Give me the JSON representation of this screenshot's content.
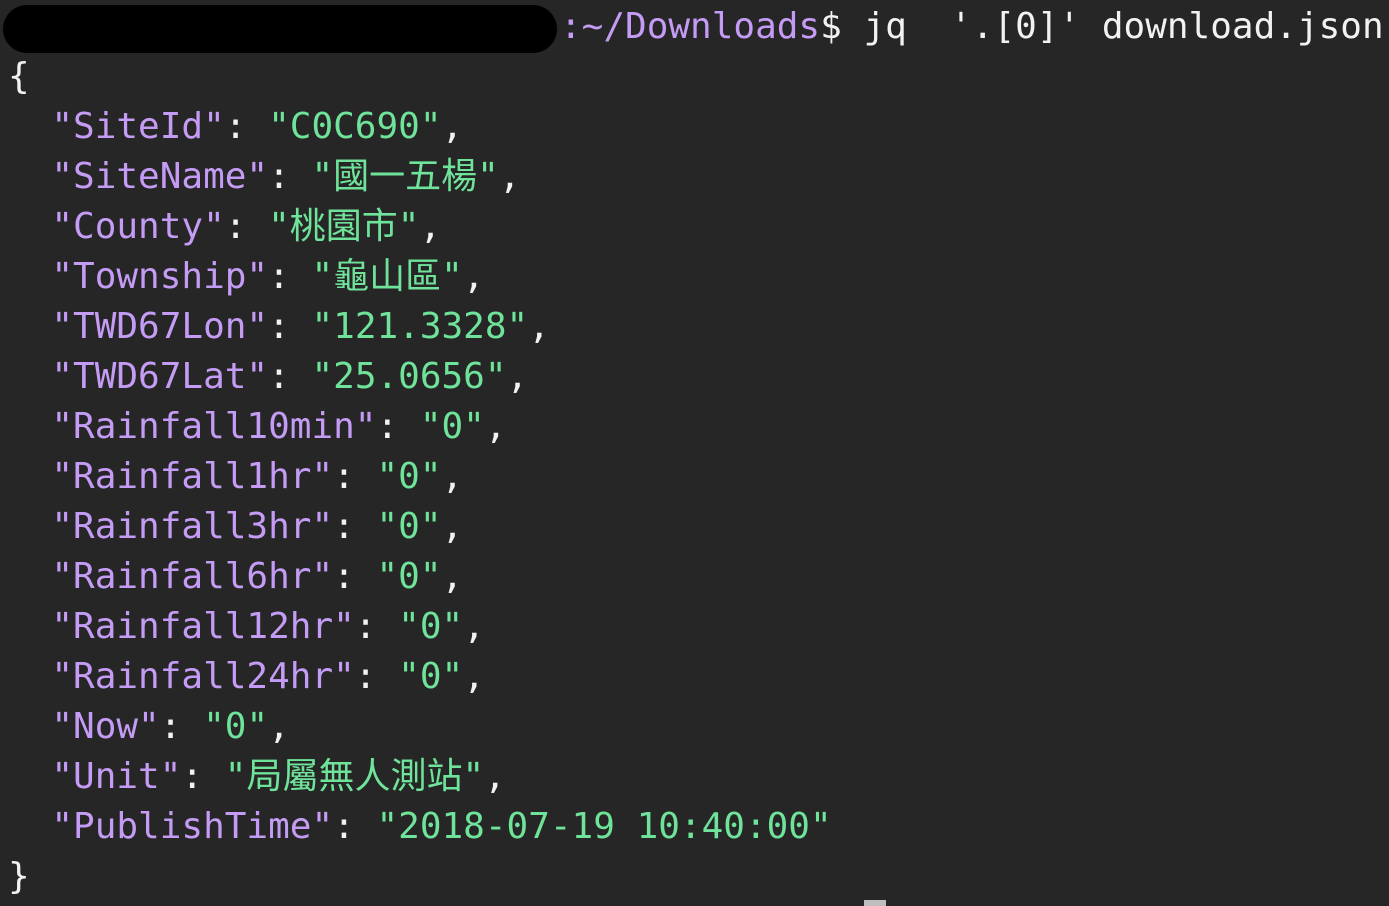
{
  "prompt": {
    "path": ":~/Downloads",
    "symbol": "$ ",
    "command": "jq  '.[0]' download.json"
  },
  "open_brace": "{",
  "close_brace": "}",
  "entries": [
    {
      "key": "\"SiteId\"",
      "value": "\"C0C690\"",
      "comma": ","
    },
    {
      "key": "\"SiteName\"",
      "value": "\"國一五楊\"",
      "comma": ","
    },
    {
      "key": "\"County\"",
      "value": "\"桃園市\"",
      "comma": ","
    },
    {
      "key": "\"Township\"",
      "value": "\"龜山區\"",
      "comma": ","
    },
    {
      "key": "\"TWD67Lon\"",
      "value": "\"121.3328\"",
      "comma": ","
    },
    {
      "key": "\"TWD67Lat\"",
      "value": "\"25.0656\"",
      "comma": ","
    },
    {
      "key": "\"Rainfall10min\"",
      "value": "\"0\"",
      "comma": ","
    },
    {
      "key": "\"Rainfall1hr\"",
      "value": "\"0\"",
      "comma": ","
    },
    {
      "key": "\"Rainfall3hr\"",
      "value": "\"0\"",
      "comma": ","
    },
    {
      "key": "\"Rainfall6hr\"",
      "value": "\"0\"",
      "comma": ","
    },
    {
      "key": "\"Rainfall12hr\"",
      "value": "\"0\"",
      "comma": ","
    },
    {
      "key": "\"Rainfall24hr\"",
      "value": "\"0\"",
      "comma": ","
    },
    {
      "key": "\"Now\"",
      "value": "\"0\"",
      "comma": ","
    },
    {
      "key": "\"Unit\"",
      "value": "\"局屬無人測站\"",
      "comma": ","
    },
    {
      "key": "\"PublishTime\"",
      "value": "\"2018-07-19 10:40:00\"",
      "comma": ""
    }
  ],
  "colors": {
    "background": "#262626",
    "key": "#c59cf5",
    "string": "#6fe39a",
    "text": "#f2f2f2"
  }
}
